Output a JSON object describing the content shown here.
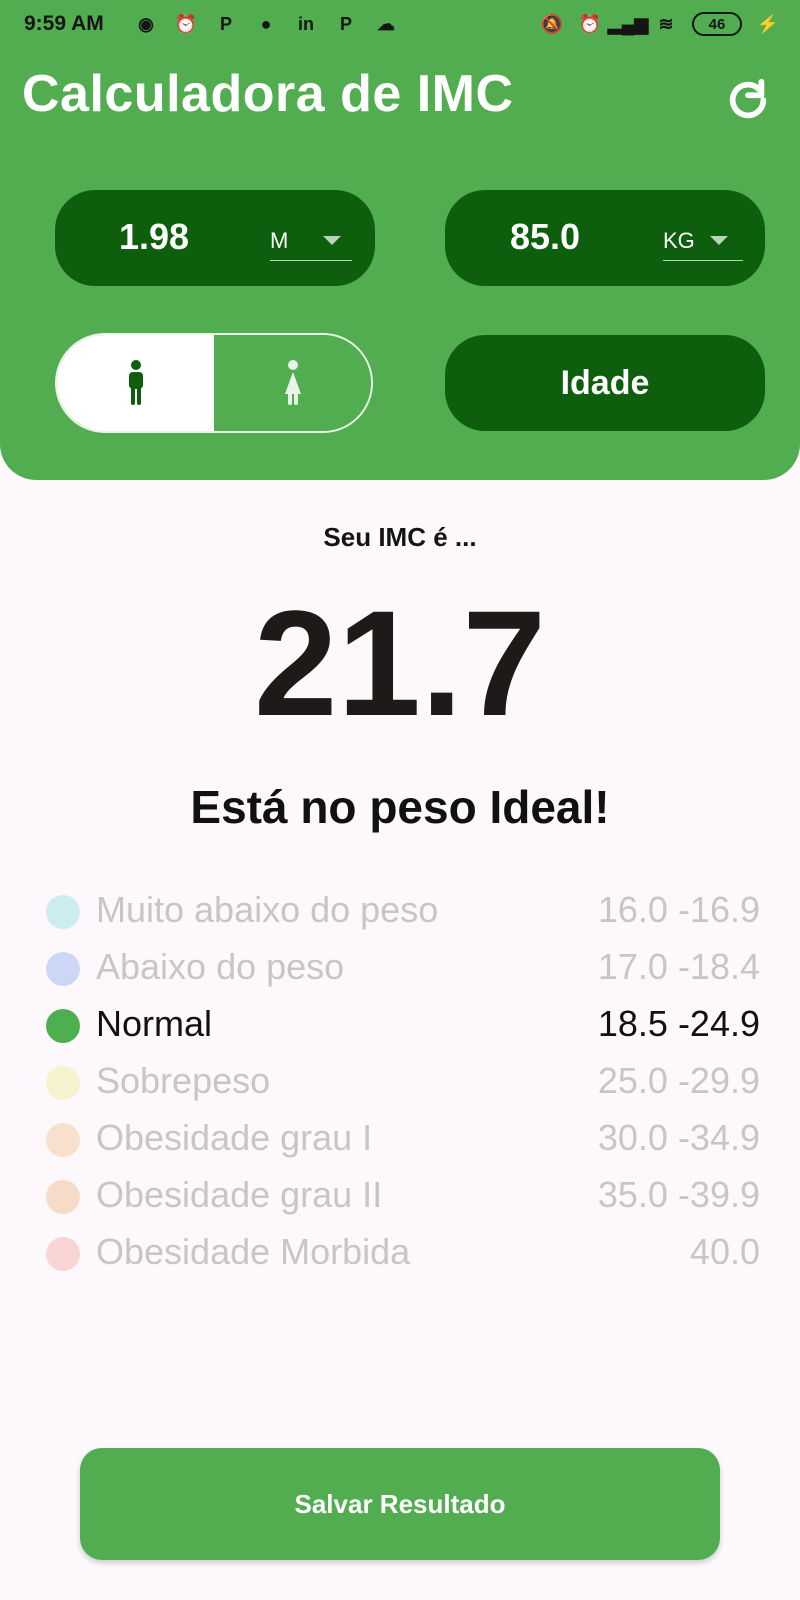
{
  "status_bar": {
    "time": "9:59 AM",
    "battery": "46"
  },
  "app": {
    "title": "Calculadora de IMC",
    "refresh_icon": "refresh-icon"
  },
  "inputs": {
    "height": {
      "value": "1.98",
      "unit": "M"
    },
    "weight": {
      "value": "85.0",
      "unit": "KG"
    },
    "sex_options": [
      "male",
      "female"
    ],
    "age_button": "Idade"
  },
  "result": {
    "intro": "Seu IMC é ...",
    "value": "21.7",
    "message": "Está no peso Ideal!"
  },
  "ranges": [
    {
      "label": "Muito abaixo do peso",
      "range": "16.0 -16.9",
      "color": "#ccecef"
    },
    {
      "label": "Abaixo do peso",
      "range": "17.0 -18.4",
      "color": "#ccd7f5"
    },
    {
      "label": "Normal",
      "range": "18.5 -24.9",
      "color": "#4caf50",
      "active": true
    },
    {
      "label": "Sobrepeso",
      "range": "25.0 -29.9",
      "color": "#f6f2cc"
    },
    {
      "label": "Obesidade grau I",
      "range": "30.0 -34.9",
      "color": "#f7e1cc"
    },
    {
      "label": "Obesidade grau II",
      "range": "35.0 -39.9",
      "color": "#f6dcc8"
    },
    {
      "label": "Obesidade Morbida",
      "range": "40.0",
      "color": "#f7d5d5"
    }
  ],
  "actions": {
    "save": "Salvar Resultado"
  },
  "colors": {
    "primary": "#52ad50",
    "dark": "#0d5f0e",
    "background": "#fdf8fc"
  }
}
